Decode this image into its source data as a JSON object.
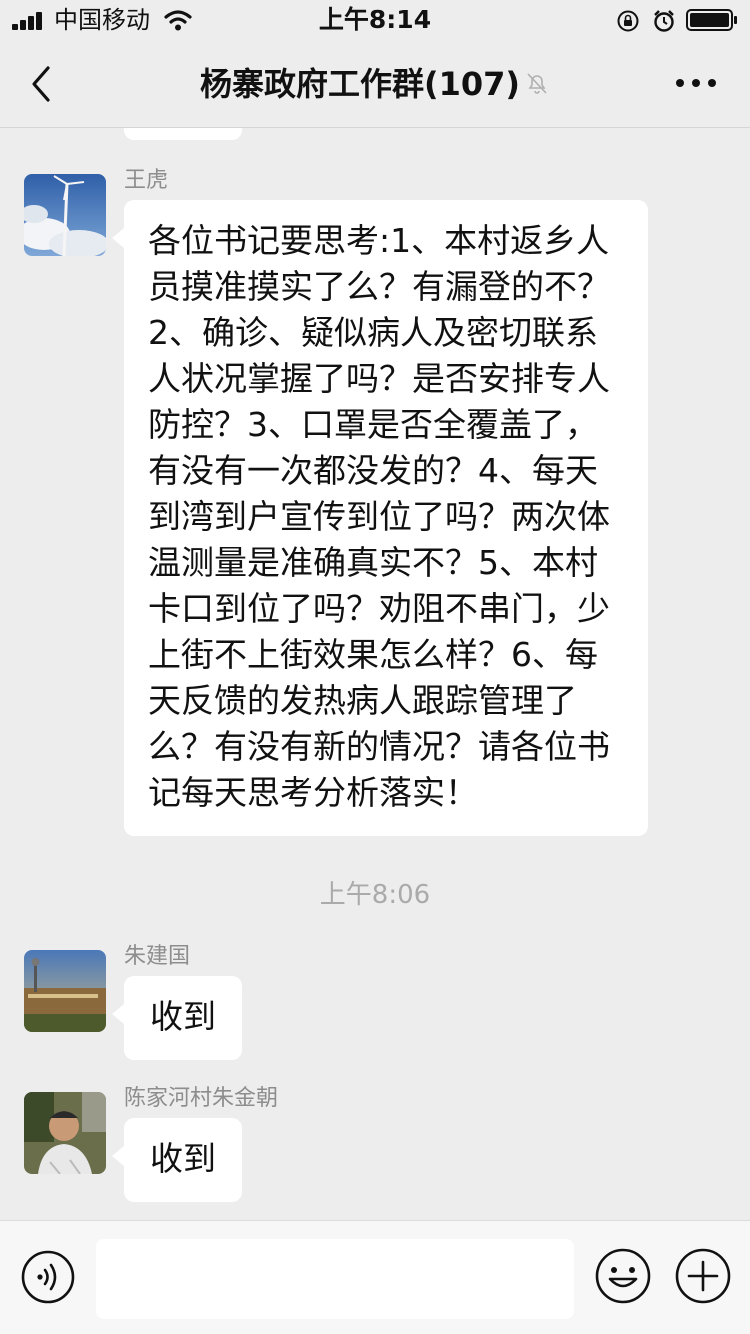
{
  "status_bar": {
    "carrier": "中国移动",
    "time": "上午8:14",
    "icons": [
      "signal-icon",
      "wifi-icon",
      "rotation-lock-icon",
      "alarm-icon",
      "battery-icon"
    ]
  },
  "nav": {
    "title": "杨寨政府工作群(107)",
    "icons": [
      "back-arrow-icon",
      "mute-bell-icon",
      "more-icon"
    ]
  },
  "messages": [
    {
      "sender": "王虎",
      "text": "各位书记要思考:1、本村返乡人员摸准摸实了么？有漏登的不？2、确诊、疑似病人及密切联系人状况掌握了吗？是否安排专人防控？3、口罩是否全覆盖了，有没有一次都没发的？4、每天到湾到户宣传到位了吗？两次体温测量是准确真实不？5、本村卡口到位了吗？劝阻不串门，少上街不上街效果怎么样？6、每天反馈的发热病人跟踪管理了么？有没有新的情况？请各位书记每天思考分析落实！"
    },
    {
      "sender": "朱建国",
      "text": "收到"
    },
    {
      "sender": "陈家河村朱金朝",
      "text": "收到"
    }
  ],
  "timestamp": "上午8:06",
  "input_bar": {
    "placeholder": "",
    "icons": [
      "voice-icon",
      "emoji-icon",
      "plus-icon"
    ]
  },
  "colors": {
    "background": "#ededed",
    "bubble": "#ffffff",
    "sender_text": "#8d8d8d",
    "timestamp_text": "#aaaaaa"
  }
}
